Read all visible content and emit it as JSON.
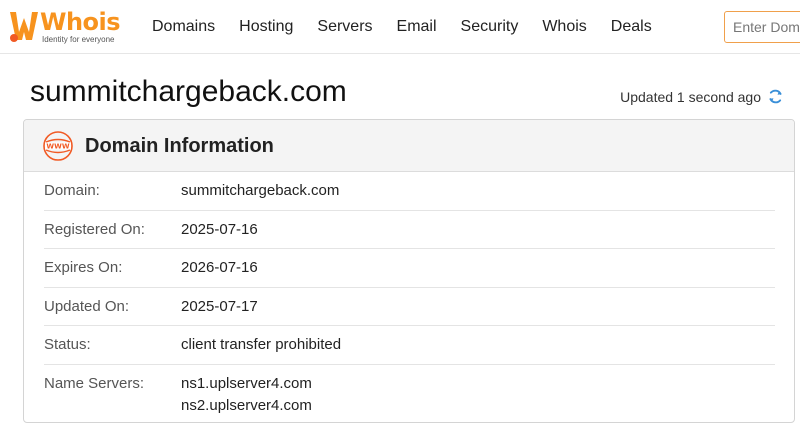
{
  "brand": {
    "name": "Whois",
    "tagline": "Identity for everyone",
    "accent_color": "#f7931e"
  },
  "nav": {
    "items": [
      "Domains",
      "Hosting",
      "Servers",
      "Email",
      "Security",
      "Whois",
      "Deals"
    ]
  },
  "search": {
    "placeholder": "Enter Domain or IP"
  },
  "page": {
    "title": "summitchargeback.com",
    "updated_text": "Updated 1 second ago",
    "refresh_icon": "refresh-icon"
  },
  "card": {
    "title": "Domain Information",
    "icon": "www-icon",
    "rows": [
      {
        "label": "Domain:",
        "value": "summitchargeback.com"
      },
      {
        "label": "Registered On:",
        "value": "2025-07-16"
      },
      {
        "label": "Expires On:",
        "value": "2026-07-16"
      },
      {
        "label": "Updated On:",
        "value": "2025-07-17"
      },
      {
        "label": "Status:",
        "value": "client transfer prohibited"
      },
      {
        "label": "Name Servers:",
        "values": [
          "ns1.uplserver4.com",
          "ns2.uplserver4.com"
        ]
      }
    ]
  }
}
